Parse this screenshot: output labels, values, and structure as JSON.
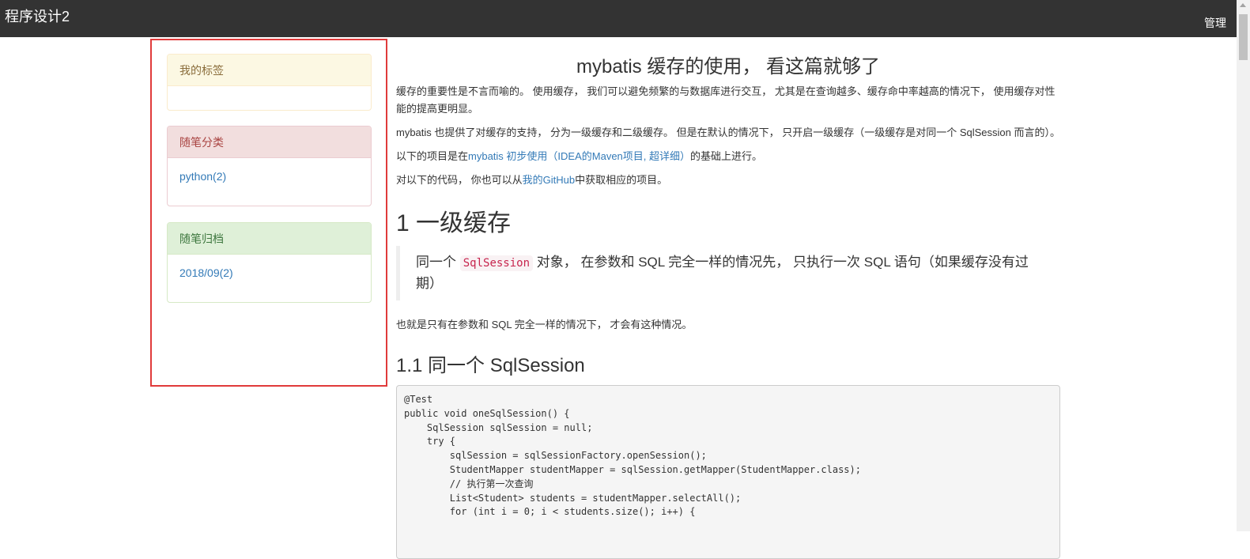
{
  "header": {
    "title": "程序设计2",
    "admin": "管理"
  },
  "sidebar": {
    "tags": {
      "heading": "我的标签"
    },
    "categories": {
      "heading": "随笔分类",
      "items": [
        "python(2)"
      ]
    },
    "archive": {
      "heading": "随笔归档",
      "items": [
        "2018/09(2)"
      ]
    }
  },
  "article": {
    "title": "mybatis 缓存的使用， 看这篇就够了",
    "p1": "缓存的重要性是不言而喻的。 使用缓存， 我们可以避免频繁的与数据库进行交互， 尤其是在查询越多、缓存命中率越高的情况下， 使用缓存对性能的提高更明显。",
    "p2": "mybatis 也提供了对缓存的支持， 分为一级缓存和二级缓存。 但是在默认的情况下， 只开启一级缓存（一级缓存是对同一个 SqlSession 而言的）。",
    "p3_before": "以下的项目是在",
    "p3_link": "mybatis 初步使用（IDEA的Maven项目, 超详细）",
    "p3_after": "的基础上进行。",
    "p4_before": "对以下的代码， 你也可以从",
    "p4_link": "我的GitHub",
    "p4_after": "中获取相应的项目。",
    "h1": "1 一级缓存",
    "quote_before": "同一个 ",
    "quote_code": "SqlSession",
    "quote_after": " 对象， 在参数和 SQL 完全一样的情况先， 只执行一次 SQL 语句（如果缓存没有过期）",
    "p5": "也就是只有在参数和 SQL 完全一样的情况下， 才会有这种情况。",
    "h2": "1.1 同一个 SqlSession",
    "code": [
      "@Test",
      "public void oneSqlSession() {",
      "    SqlSession sqlSession = null;",
      "    try {",
      "        sqlSession = sqlSessionFactory.openSession();",
      "",
      "        StudentMapper studentMapper = sqlSession.getMapper(StudentMapper.class);",
      "        // 执行第一次查询",
      "        List<Student> students = studentMapper.selectAll();",
      "        for (int i = 0; i < students.size(); i++) {"
    ]
  }
}
